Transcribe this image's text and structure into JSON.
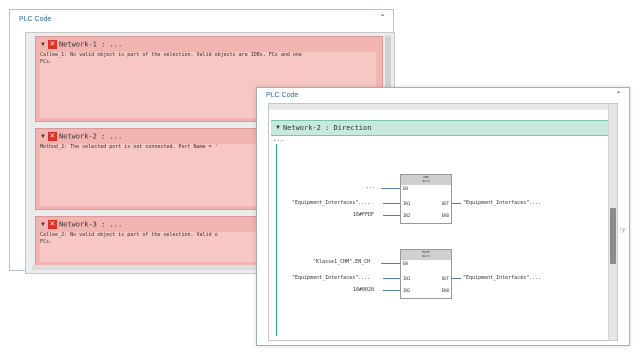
{
  "back_panel": {
    "title": "PLC Code",
    "networks": [
      {
        "title": "Network-1 : ...",
        "message": "Callee_1: No valid object is part of the selection. Valid objects are IDBs, FCs and one\nFCs."
      },
      {
        "title": "Network-2 : ...",
        "message": "Method_2: The selected port is not connected. Port Name = '"
      },
      {
        "title": "Network-3 : ...",
        "message": "Callee_2: No valid object is part of the selection. Valid o\nFCs."
      }
    ]
  },
  "front_panel": {
    "title": "PLC Code",
    "network": {
      "title": "Network-2 : Direction",
      "comment": "...",
      "blocks": [
        {
          "header": "AND\nWord",
          "en_signal": "...",
          "pins": {
            "en": "EN",
            "in1": "IN1",
            "in2": "IN2",
            "out": "OUT",
            "eno": "ENO"
          },
          "in1_signal": "\"Equipment_Interfaces\"....",
          "in2_signal": "16#FFDF",
          "out_signal": "\"Equipment_Interfaces\"...."
        },
        {
          "header": "MOVE\nWord",
          "en_signal": "\"Klasse1_CHM\".EN_CH",
          "pins": {
            "en": "EN",
            "in1": "IN1",
            "in2": "IN2",
            "out": "OUT",
            "eno": "ENO"
          },
          "in1_signal": "\"Equipment_Interfaces\"....",
          "in2_signal": "16#0020",
          "out_signal": "\"Equipment_Interfaces\"...."
        }
      ]
    }
  },
  "icons": {
    "collapse": "chevron-up-icon",
    "expand_toggle": "triangle-down-icon",
    "error": "error-x-icon",
    "cursor": "mouse-pointer-icon"
  },
  "colors": {
    "title_blue": "#2e6da4",
    "error_red": "#d9322b",
    "error_bg": "#f2b4b0",
    "network_header_green": "#c8e9e0"
  }
}
